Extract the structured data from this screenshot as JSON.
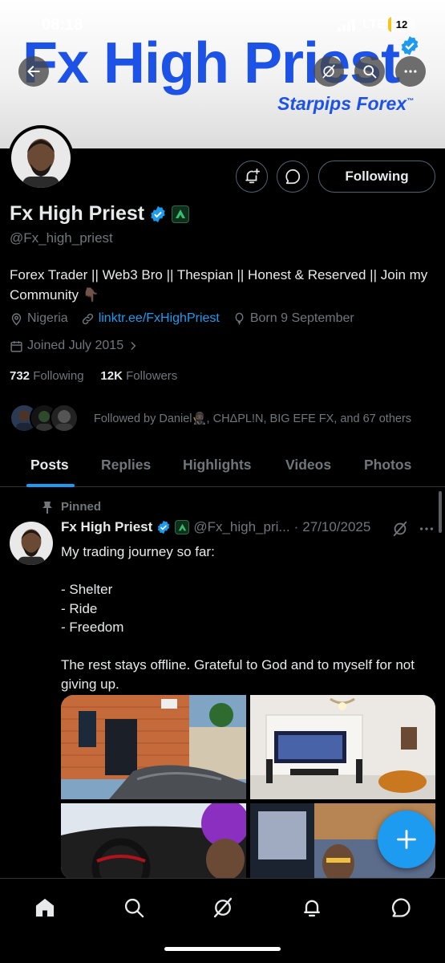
{
  "status_bar": {
    "time": "08:18",
    "network": "LTE",
    "battery": "12",
    "battery_level": 0.12
  },
  "banner": {
    "title": "Fx High Priest",
    "subtitle": "Starpips Forex",
    "trademark": "™"
  },
  "header_icons": [
    "back-arrow-icon",
    "grok-icon",
    "search-icon",
    "more-icon"
  ],
  "profile": {
    "name": "Fx High Priest",
    "handle": "@Fx_high_priest",
    "bio": "Forex Trader || Web3 Bro || Thespian || Honest & Reserved || Join my Community 👇🏿",
    "location": "Nigeria",
    "link": "linktr.ee/FxHighPriest",
    "birthday": "Born 9 September",
    "joined": "Joined July 2015",
    "following_count": "732",
    "following_label": "Following",
    "followers_count": "12K",
    "followers_label": "Followers",
    "followed_by": "Followed by Daniel🥷🏿, CHΔPL!N, BIG EFE FX, and 67 others",
    "follow_button_label": "Following"
  },
  "tabs": [
    {
      "label": "Posts",
      "active": true
    },
    {
      "label": "Replies",
      "active": false
    },
    {
      "label": "Highlights",
      "active": false
    },
    {
      "label": "Videos",
      "active": false
    },
    {
      "label": "Photos",
      "active": false
    }
  ],
  "pinned_post": {
    "pinned_label": "Pinned",
    "author": "Fx High Priest",
    "handle": "@Fx_high_pri...",
    "separator": "·",
    "date": "27/10/2025",
    "text": "My trading journey so far:\n\n- Shelter\n- Ride\n- Freedom\n\nThe rest stays offline. Grateful to God and to myself for not giving up.",
    "media_count": 4
  },
  "bottom_nav": [
    "home-icon",
    "search-icon",
    "grok-icon",
    "notifications-icon",
    "messages-icon"
  ],
  "colors": {
    "accent": "#1d9bf0",
    "background": "#000000",
    "muted": "#71767b",
    "text": "#e7e9ea",
    "banner_blue": "#1d52e6"
  }
}
